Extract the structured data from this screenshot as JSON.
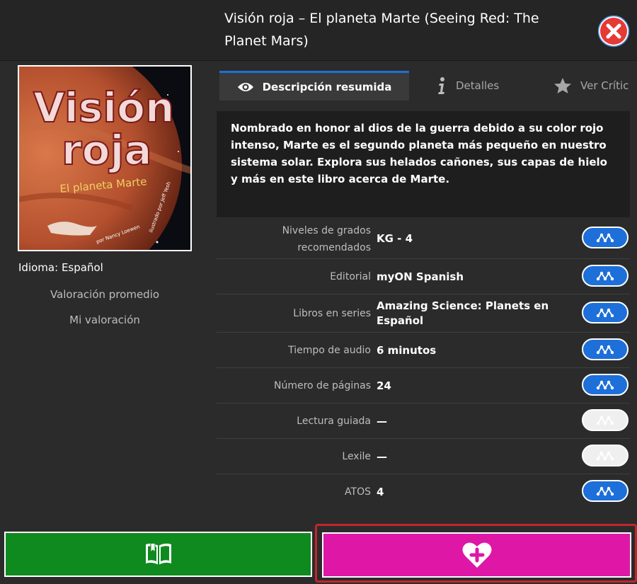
{
  "header": {
    "title": "Visión roja – El planeta Marte (Seeing Red: The Planet Mars)"
  },
  "book": {
    "cover_title_line1": "Visión",
    "cover_title_line2": "roja",
    "cover_subtitle": "El planeta Marte",
    "cover_author": "por Nancy Loewen",
    "cover_illustrator": "ilustrado por Jeff Yesh",
    "language_label": "Idioma:",
    "language_value": "Español",
    "rating_avg_label": "Valoración promedio",
    "rating_my_label": "Mi valoración"
  },
  "tabs": [
    {
      "label": "Descripción resumida",
      "icon": "eye-icon",
      "active": true
    },
    {
      "label": "Detalles",
      "icon": "info-icon",
      "active": false
    },
    {
      "label": "Ver Crític",
      "icon": "star-icon",
      "active": false
    }
  ],
  "description": "Nombrado en honor al dios de la guerra debido a su color rojo intenso, Marte es el segundo planeta más pequeño en nuestro sistema solar. Explora sus helados cañones, sus capas de hielo y más en este libro acerca de Marte.",
  "details": [
    {
      "label": "Niveles de grados recomendados",
      "value": "KG - 4",
      "enabled": true
    },
    {
      "label": "Editorial",
      "value": "myON Spanish",
      "enabled": true
    },
    {
      "label": "Libros en series",
      "value": "Amazing Science: Planets en Español",
      "enabled": true
    },
    {
      "label": "Tiempo de audio",
      "value": "6 minutos",
      "enabled": true
    },
    {
      "label": "Número de páginas",
      "value": "24",
      "enabled": true
    },
    {
      "label": "Lectura guiada",
      "value": "—",
      "enabled": false
    },
    {
      "label": "Lexile",
      "value": "—",
      "enabled": false
    },
    {
      "label": "ATOS",
      "value": "4",
      "enabled": true
    }
  ],
  "colors": {
    "accent_blue": "#1d6fd9",
    "read_green": "#0f8a1f",
    "favorite_magenta": "#de17a6",
    "close_red": "#e53935"
  }
}
